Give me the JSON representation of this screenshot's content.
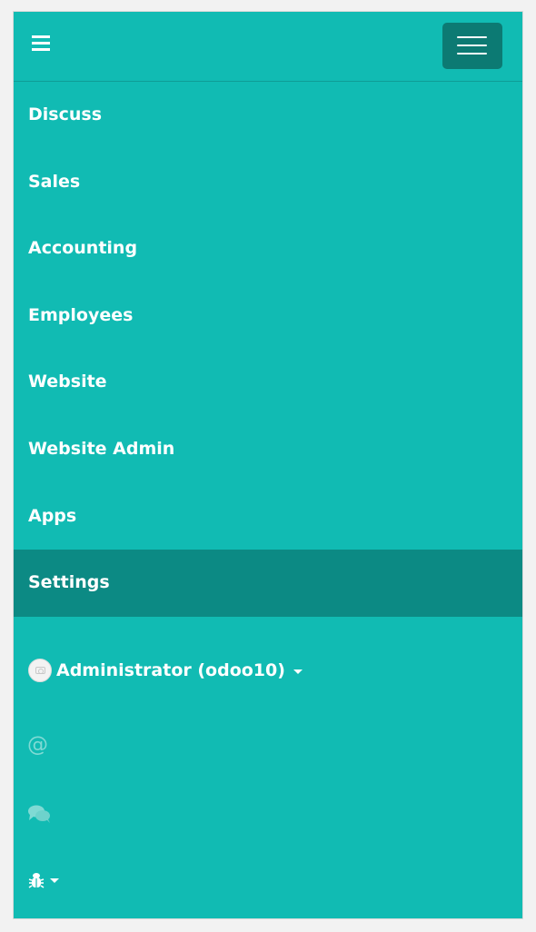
{
  "menu": {
    "items": [
      {
        "label": "Discuss"
      },
      {
        "label": "Sales"
      },
      {
        "label": "Accounting"
      },
      {
        "label": "Employees"
      },
      {
        "label": "Website"
      },
      {
        "label": "Website Admin"
      },
      {
        "label": "Apps"
      },
      {
        "label": "Settings",
        "active": true
      }
    ]
  },
  "user": {
    "name": "Administrator (odoo10)",
    "avatar_icon": "camera-icon"
  },
  "systray": {
    "mentions_symbol": "@",
    "chat_icon": "comments-icon",
    "debug_icon": "bug-icon"
  },
  "colors": {
    "navbar": "#11bbb3",
    "active_item": "#0c8a84",
    "toggle_button": "#0c7a73",
    "muted_icon": "#7fdad4"
  }
}
